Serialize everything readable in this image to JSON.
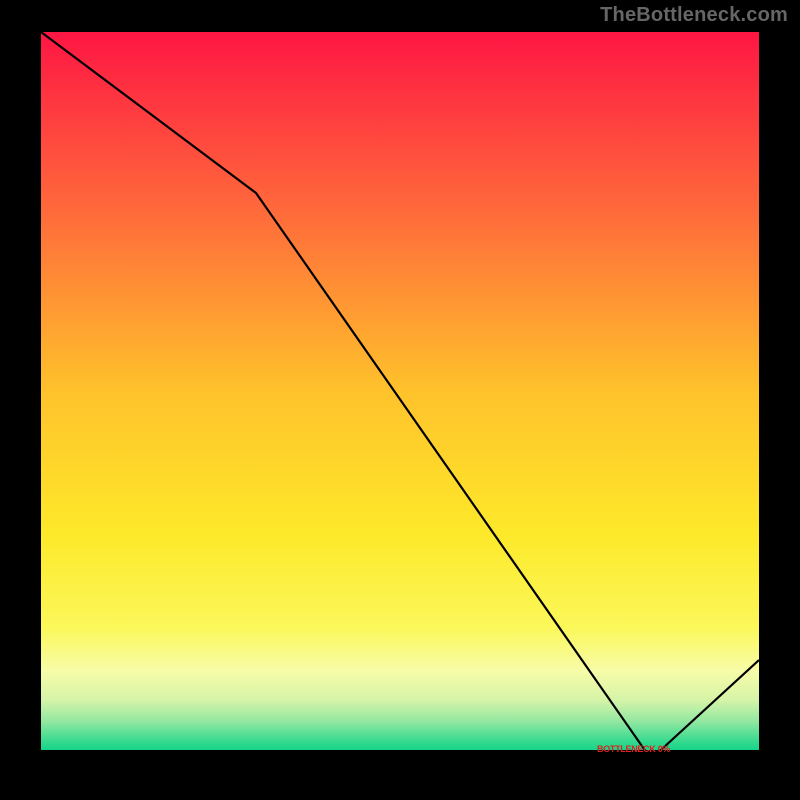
{
  "watermark": "TheBottleneck.com",
  "marker_text": "BOTTLENECK 0%",
  "chart_data": {
    "type": "line",
    "title": "",
    "xlabel": "",
    "ylabel": "",
    "xlim": [
      0,
      100
    ],
    "ylim": [
      0,
      100
    ],
    "x": [
      0,
      30,
      85,
      100
    ],
    "values": [
      100,
      78,
      0,
      14
    ],
    "background_gradient_stops": [
      {
        "p": 0.0,
        "c": "#fe1643"
      },
      {
        "p": 0.25,
        "c": "#ff6a3b"
      },
      {
        "p": 0.5,
        "c": "#ffc22b"
      },
      {
        "p": 0.7,
        "c": "#fde92a"
      },
      {
        "p": 0.83,
        "c": "#fbf85a"
      },
      {
        "p": 0.89,
        "c": "#f7fca8"
      },
      {
        "p": 0.93,
        "c": "#d6f4a8"
      },
      {
        "p": 0.96,
        "c": "#93e8a1"
      },
      {
        "p": 0.99,
        "c": "#2fd98e"
      },
      {
        "p": 1.0,
        "c": "#17d488"
      }
    ],
    "ideal_point_xfrac": 0.85,
    "ideal_label": "BOTTLENECK 0%"
  }
}
